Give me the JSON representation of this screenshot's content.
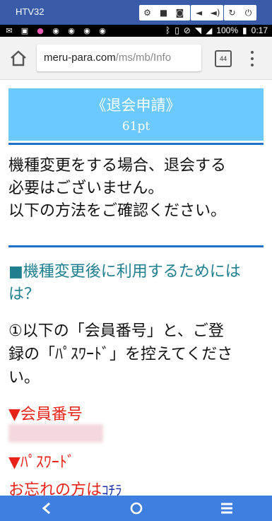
{
  "emulator": {
    "title": "HTV32"
  },
  "status_bar": {
    "battery_percent": "100%",
    "time": "0:17"
  },
  "browser": {
    "url_host": "meru-para.com",
    "url_path": "/ms/mb/Info",
    "tab_count": "44"
  },
  "header": {
    "title": "《退会申請》",
    "points": "61pt"
  },
  "paragraph": {
    "line1": "機種変更をする場合、退会する",
    "line2": "必要はございません。",
    "line3": "以下の方法をご確認ください。"
  },
  "section": {
    "line1": "■機種変更後に利用するためには",
    "line2": "は？"
  },
  "step": {
    "line1": "①以下の「会員番号」と、ご登",
    "line2": "録の「ﾊﾟｽﾜｰﾄﾞ」を控えてくださ",
    "line3": "い。"
  },
  "member_number_label": "▼会員番号",
  "password_label": "▼ﾊﾟｽﾜｰﾄﾞ",
  "forgot": {
    "text": "お忘れの方は",
    "link": "ｺﾁﾗ"
  },
  "colors": {
    "header_bg": "#6cc9ff",
    "divider": "#1e6fce",
    "section_text": "#1f7f8f",
    "red": "#e8231a",
    "link": "#1b2fa8",
    "nav_bar": "#3f7fe0",
    "emulator_bar": "#3a5ca8"
  },
  "icons": [
    "settings-icon",
    "video-icon",
    "camera-icon",
    "volume-down-icon",
    "volume-up-icon",
    "rotate-icon",
    "power-icon",
    "home-icon",
    "back-icon",
    "circle-home-icon",
    "menu-icon"
  ]
}
